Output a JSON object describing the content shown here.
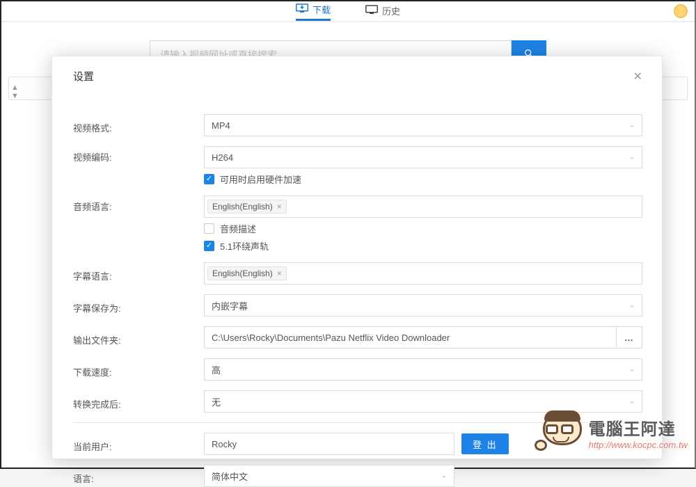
{
  "bg": {
    "tab_download": "下载",
    "tab_history": "历史",
    "search_placeholder": "请输入视频网址或直接搜索"
  },
  "modal": {
    "title": "设置",
    "labels": {
      "video_format": "视频格式:",
      "video_codec": "视频编码:",
      "audio_language": "音频语言:",
      "subtitle_language": "字幕语言:",
      "subtitle_save_as": "字幕保存为:",
      "output_folder": "输出文件夹:",
      "download_speed": "下载速度:",
      "after_convert": "转换完成后:",
      "current_user": "当前用户:",
      "language": "语言:"
    },
    "values": {
      "video_format": "MP4",
      "video_codec": "H264",
      "subtitle_save_as": "内嵌字幕",
      "output_folder": "C:\\Users\\Rocky\\Documents\\Pazu Netflix Video Downloader",
      "download_speed": "高",
      "after_convert": "无",
      "current_user": "Rocky",
      "language": "简体中文"
    },
    "tags": {
      "audio": "English(English)",
      "subtitle": "English(English)"
    },
    "checks": {
      "hw_accel": "可用时启用硬件加速",
      "audio_describe": "音频描述",
      "surround": "5.1环绕声轨"
    },
    "logout": "登 出"
  },
  "watermark": {
    "title": "電腦王阿達",
    "url": "http://www.kocpc.com.tw"
  }
}
